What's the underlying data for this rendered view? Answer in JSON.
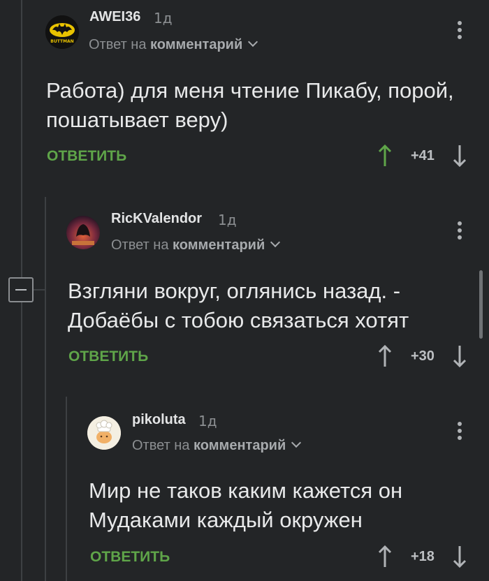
{
  "comments": [
    {
      "username": "AWEI36",
      "time": "1д",
      "reply_prefix": "Ответ на",
      "reply_target": "комментарий",
      "avatar_text": "BUTTMAN",
      "text_line1": "Работа) для меня чтение Пикабу, порой,",
      "text_line2": "пошатывает веру)",
      "reply_label": "ОТВЕТИТЬ",
      "rating": "+41",
      "upvoted": true
    },
    {
      "username": "RicKValendor",
      "time": "1д",
      "reply_prefix": "Ответ на",
      "reply_target": "комментарий",
      "text_line1": "Взгляни вокруг, оглянись назад. -",
      "text_line2": "Добаёбы с тобою связаться хотят",
      "reply_label": "ОТВЕТИТЬ",
      "rating": "+30",
      "upvoted": false
    },
    {
      "username": "pikoluta",
      "time": "1д",
      "reply_prefix": "Ответ на",
      "reply_target": "комментарий",
      "text_line1": "Мир не таков каким кажется он",
      "text_line2": "Мудаками каждый окружен",
      "reply_label": "ОТВЕТИТЬ",
      "rating": "+18",
      "upvoted": false
    }
  ],
  "colors": {
    "background": "#232527",
    "accent_green": "#5fa549",
    "text": "#e8e9ea",
    "muted": "#8c8f92"
  }
}
